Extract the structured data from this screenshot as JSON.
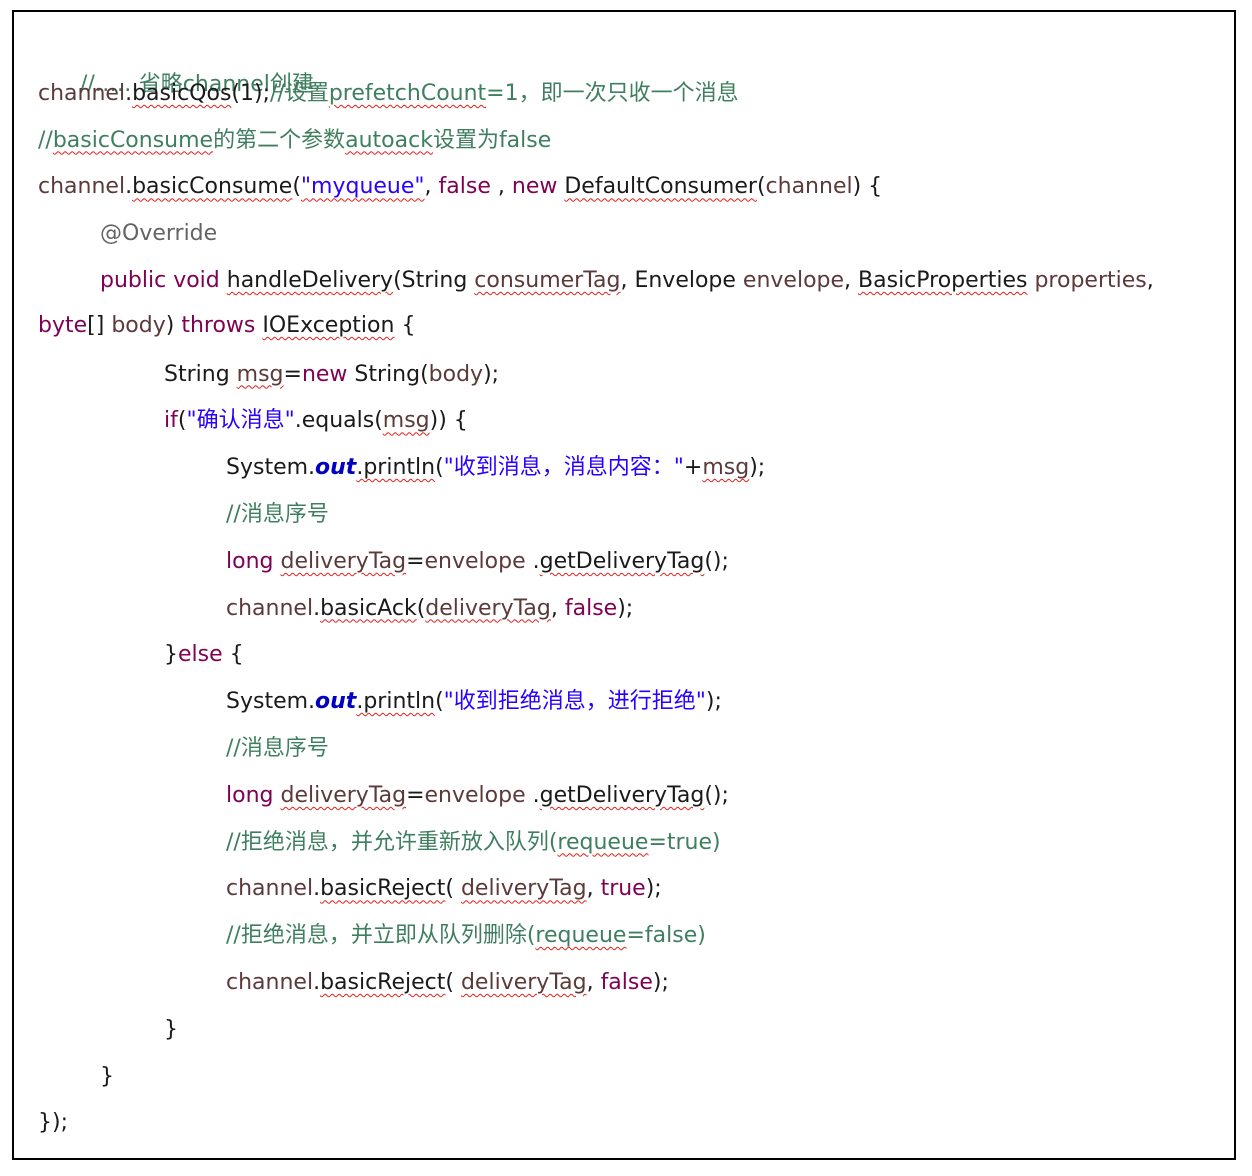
{
  "code": {
    "l1_comment": "//……省略channel创建",
    "l2_channel": "channel",
    "l2_dot": ".",
    "l2_method": "basicQos",
    "l2_args": "(1);",
    "l2_comment_a": "//设置",
    "l2_comment_b": "prefetchCount",
    "l2_comment_c": "=1，即一次只收一个消息",
    "l3_comment_a": "//",
    "l3_comment_b": "basicConsume",
    "l3_comment_c": "的第二个参数",
    "l3_comment_d": "autoack",
    "l3_comment_e": "设置为false",
    "l4_channel": "channel",
    "l4_dot": ".",
    "l4_method": "basicConsume",
    "l4_paren": "(",
    "l4_queue": "\"myqueue\"",
    "l4_sep1": ", ",
    "l4_false": "false",
    "l4_sep2": " , ",
    "l4_new": "new",
    "l4_space": " ",
    "l4_class": "DefaultConsumer",
    "l4_paren2": "(",
    "l4_ch": "channel",
    "l4_end": ") {",
    "l5_annotation": "@Override",
    "l6_public": "public",
    "l6_void": " void ",
    "l6_method": "handleDelivery",
    "l6_paren": "(String ",
    "l6_p1": "consumerTag",
    "l6_sep1": ", Envelope ",
    "l6_p2": "envelope",
    "l6_sep2": ", ",
    "l6_type3": "BasicProperties",
    "l6_sp": " ",
    "l6_p3": "properties",
    "l6_end": ",",
    "l7_byte": "byte",
    "l7_arr": "[] ",
    "l7_body": "body",
    "l7_close": ") ",
    "l7_throws": "throws",
    "l7_sp": " ",
    "l7_exc": "IOException",
    "l7_end": " {",
    "l8_type": "String ",
    "l8_var": "msg",
    "l8_eq": "=",
    "l8_new": "new",
    "l8_ctor": " String(",
    "l8_body": "body",
    "l8_end": ");",
    "l9_if": "if",
    "l9_paren": "(",
    "l9_str": "\"确认消息\"",
    "l9_eq": ".equals(",
    "l9_msg": "msg",
    "l9_end": ")) {",
    "l10_sys": "System.",
    "l10_out": "out",
    "l10_println": ".println",
    "l10_paren": "(",
    "l10_str": "\"收到消息，消息内容：\"",
    "l10_plus": "+",
    "l10_msg": "msg",
    "l10_end": ");",
    "l11_comment": "//消息序号",
    "l12_long": "long",
    "l12_sp": " ",
    "l12_var": "deliveryTag",
    "l12_eq": "=",
    "l12_env": "envelope",
    "l12_dot": " .",
    "l12_method": "getDeliveryTag",
    "l12_end": "();",
    "l13_channel": "channel",
    "l13_dot": ".",
    "l13_method": "basicAck",
    "l13_paren": "(",
    "l13_var": "deliveryTag",
    "l13_sep": ", ",
    "l13_false": "false",
    "l13_end": ");",
    "l14_brace": "}",
    "l14_else": "else",
    "l14_end": " {",
    "l15_sys": "System.",
    "l15_out": "out",
    "l15_println": ".println",
    "l15_paren": "(",
    "l15_str": "\"收到拒绝消息，进行拒绝\"",
    "l15_end": ");",
    "l16_comment": "//消息序号",
    "l17_long": "long",
    "l17_sp": " ",
    "l17_var": "deliveryTag",
    "l17_eq": "=",
    "l17_env": "envelope",
    "l17_dot": " .",
    "l17_method": "getDeliveryTag",
    "l17_end": "();",
    "l18_comment_a": "//拒绝消息，并允许重新放入队列(",
    "l18_comment_b": "requeue",
    "l18_comment_c": "=true)",
    "l19_channel": "channel",
    "l19_dot": ".",
    "l19_method": "basicReject",
    "l19_paren": "( ",
    "l19_var": "deliveryTag",
    "l19_sep": ", ",
    "l19_true": "true",
    "l19_end": ");",
    "l20_comment_a": "//拒绝消息，并立即从队列删除(",
    "l20_comment_b": "requeue",
    "l20_comment_c": "=false)",
    "l21_channel": "channel",
    "l21_dot": ".",
    "l21_method": "basicReject",
    "l21_paren": "( ",
    "l21_var": "deliveryTag",
    "l21_sep": ", ",
    "l21_false": "false",
    "l21_end": ");",
    "l22_brace": "}",
    "l23_brace": "}",
    "l24_end": "});"
  }
}
